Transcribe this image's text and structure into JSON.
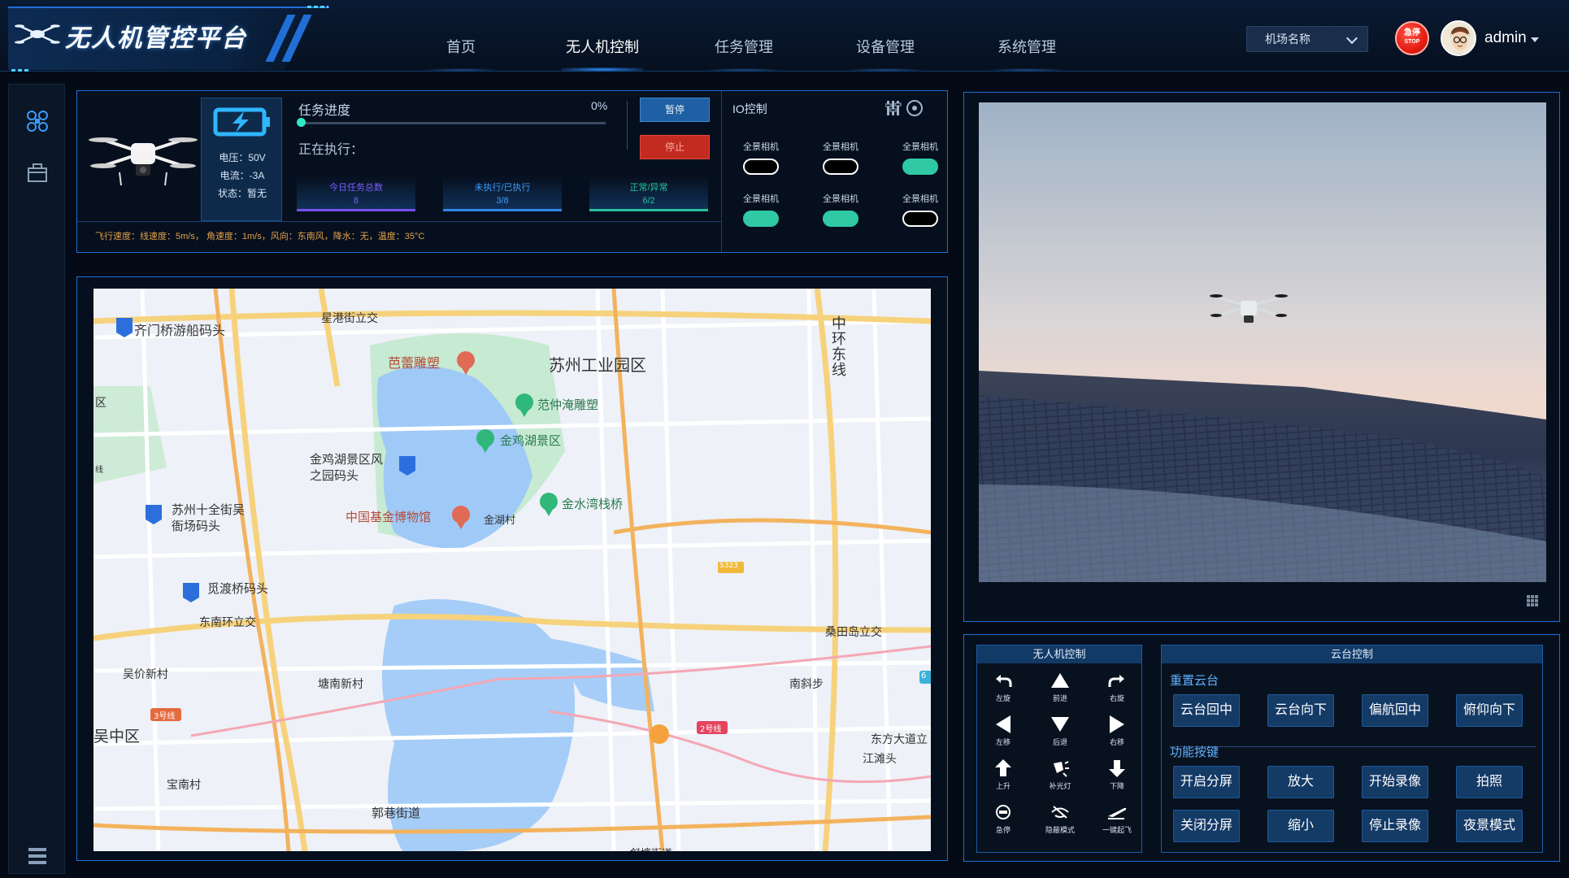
{
  "app": {
    "title": "无人机管控平台"
  },
  "nav": {
    "items": [
      {
        "label": "首页"
      },
      {
        "label": "无人机控制"
      },
      {
        "label": "任务管理"
      },
      {
        "label": "设备管理"
      },
      {
        "label": "系统管理"
      }
    ],
    "active_index": 1
  },
  "header": {
    "airport_select": "机场名称",
    "estop_label_top": "急停",
    "estop_label_bottom": "STOP",
    "username": "admin"
  },
  "sidebar": {
    "items": [
      {
        "icon": "drone-icon"
      },
      {
        "icon": "dock-icon"
      },
      {
        "icon": "menu-icon"
      }
    ]
  },
  "status": {
    "voltage": "电压：50V",
    "current": "电流：-3A",
    "state": "状态：暂无",
    "progress_title": "任务进度",
    "progress_pct": "0%",
    "progress_value": 0,
    "executing": "正在执行：",
    "pause_label": "暂停",
    "stop_label": "停止",
    "cards": [
      {
        "label": "今日任务总数",
        "value": "8",
        "color": "#7a4df0"
      },
      {
        "label": "未执行/已执行",
        "value": "3/8",
        "color": "#2f86e6"
      },
      {
        "label": "正常/异常",
        "value": "6/2",
        "color": "#25c29e"
      }
    ],
    "info": "飞行速度：线速度：5m/s， 角速度：1m/s，风向：东南风，降水：无，温度：35°C"
  },
  "io": {
    "title": "IO控制",
    "toggles": [
      {
        "label": "全景相机",
        "on": false
      },
      {
        "label": "全景相机",
        "on": false
      },
      {
        "label": "全景相机",
        "on": true
      },
      {
        "label": "全景相机",
        "on": true
      },
      {
        "label": "全景相机",
        "on": true
      },
      {
        "label": "全景相机",
        "on": false
      }
    ]
  },
  "map": {
    "labels": [
      {
        "text": "齐门桥游船码头",
        "poi": "pier"
      },
      {
        "text": "星港街立交",
        "poi": ""
      },
      {
        "text": "芭蕾雕塑",
        "poi": "poi"
      },
      {
        "text": "苏州工业园区",
        "poi": ""
      },
      {
        "text": "中环东线",
        "poi": ""
      },
      {
        "text": "范仲淹雕塑",
        "poi": "park"
      },
      {
        "text": "金鸡湖景区",
        "poi": "park"
      },
      {
        "text": "金鸡湖景区风之园码头",
        "poi": "pier"
      },
      {
        "text": "金水湾栈桥",
        "poi": "park"
      },
      {
        "text": "苏州十全街吴衙场码头",
        "poi": "pier"
      },
      {
        "text": "中国基金博物馆",
        "poi": "poi"
      },
      {
        "text": "金湖村",
        "poi": ""
      },
      {
        "text": "S323",
        "poi": ""
      },
      {
        "text": "觅渡桥码头",
        "poi": "pier"
      },
      {
        "text": "东南环立交",
        "poi": ""
      },
      {
        "text": "桑田岛立交",
        "poi": ""
      },
      {
        "text": "吴价新村",
        "poi": ""
      },
      {
        "text": "塘南新村",
        "poi": ""
      },
      {
        "text": "南斜步",
        "poi": ""
      },
      {
        "text": "3号线",
        "poi": ""
      },
      {
        "text": "2号线",
        "poi": ""
      },
      {
        "text": "吴中区",
        "poi": ""
      },
      {
        "text": "东方大道立",
        "poi": ""
      },
      {
        "text": "江滩头",
        "poi": ""
      },
      {
        "text": "宝南村",
        "poi": ""
      },
      {
        "text": "郭巷街道",
        "poi": ""
      },
      {
        "text": "区",
        "poi": ""
      },
      {
        "text": "线",
        "poi": ""
      },
      {
        "text": "6",
        "poi": ""
      },
      {
        "text": "斜塘街道",
        "poi": ""
      }
    ]
  },
  "drone_control": {
    "title": "无人机控制",
    "buttons": [
      {
        "label": "左旋",
        "icon": "rotate-left-icon"
      },
      {
        "label": "前进",
        "icon": "triangle-up-icon"
      },
      {
        "label": "右旋",
        "icon": "rotate-right-icon"
      },
      {
        "label": "左移",
        "icon": "triangle-left-icon"
      },
      {
        "label": "后退",
        "icon": "triangle-down-icon"
      },
      {
        "label": "右移",
        "icon": "triangle-right-icon"
      },
      {
        "label": "上升",
        "icon": "arrow-up-icon"
      },
      {
        "label": "补光灯",
        "icon": "light-icon"
      },
      {
        "label": "下降",
        "icon": "arrow-down-icon"
      },
      {
        "label": "急停",
        "icon": "stop-icon"
      },
      {
        "label": "隐蔽模式",
        "icon": "hidden-icon"
      },
      {
        "label": "一键起飞",
        "icon": "takeoff-icon"
      }
    ]
  },
  "gimbal_control": {
    "title": "云台控制",
    "reset_title": "重置云台",
    "reset_buttons": [
      "云台回中",
      "云台向下",
      "偏航回中",
      "俯仰向下"
    ],
    "func_title": "功能按键",
    "func_buttons": [
      "开启分屏",
      "放大",
      "开始录像",
      "拍照",
      "关闭分屏",
      "缩小",
      "停止录像",
      "夜景模式"
    ]
  },
  "colors": {
    "accent": "#1d6fd8",
    "toggle_on": "#2fc9a3",
    "estop": "#e51d12",
    "info_text": "#e0a04a",
    "section_title": "#5fb0ff"
  }
}
